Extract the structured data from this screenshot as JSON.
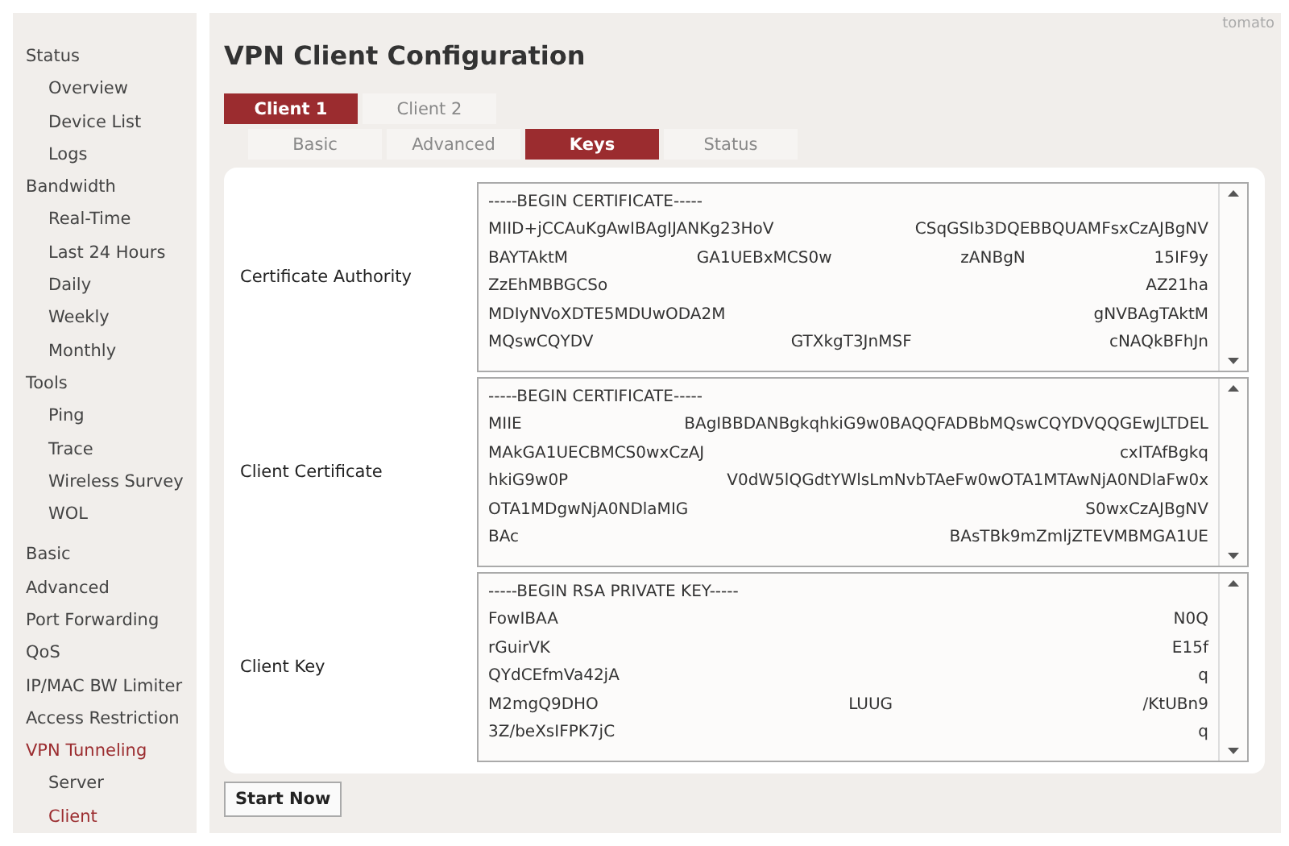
{
  "brand": "tomato",
  "sidebar": {
    "groups": [
      {
        "label": "Status",
        "selected": false,
        "children": [
          {
            "label": "Overview",
            "selected": false
          },
          {
            "label": "Device List",
            "selected": false
          },
          {
            "label": "Logs",
            "selected": false
          }
        ]
      },
      {
        "label": "Bandwidth",
        "selected": false,
        "children": [
          {
            "label": "Real-Time",
            "selected": false
          },
          {
            "label": "Last 24 Hours",
            "selected": false
          },
          {
            "label": "Daily",
            "selected": false
          },
          {
            "label": "Weekly",
            "selected": false
          },
          {
            "label": "Monthly",
            "selected": false
          }
        ]
      },
      {
        "label": "Tools",
        "selected": false,
        "children": [
          {
            "label": "Ping",
            "selected": false
          },
          {
            "label": "Trace",
            "selected": false
          },
          {
            "label": "Wireless Survey",
            "selected": false
          },
          {
            "label": "WOL",
            "selected": false
          }
        ]
      }
    ],
    "sections": [
      {
        "label": "Basic",
        "selected": false
      },
      {
        "label": "Advanced",
        "selected": false
      },
      {
        "label": "Port Forwarding",
        "selected": false
      },
      {
        "label": "QoS",
        "selected": false
      },
      {
        "label": "IP/MAC BW Limiter",
        "selected": false
      },
      {
        "label": "Access Restriction",
        "selected": false
      },
      {
        "label": "VPN Tunneling",
        "selected": true,
        "children": [
          {
            "label": "Server",
            "selected": false
          },
          {
            "label": "Client",
            "selected": true
          }
        ]
      }
    ]
  },
  "title": "VPN Client Configuration",
  "client_tabs": [
    {
      "label": "Client 1",
      "selected": true
    },
    {
      "label": "Client 2",
      "selected": false
    }
  ],
  "section_tabs": [
    {
      "label": "Basic",
      "selected": false
    },
    {
      "label": "Advanced",
      "selected": false
    },
    {
      "label": "Keys",
      "selected": true
    },
    {
      "label": "Status",
      "selected": false
    }
  ],
  "fields": [
    {
      "label": "Certificate Authority",
      "lines": [
        [
          "-----BEGIN CERTIFICATE-----"
        ],
        [
          "MIID+jCCAuKgAwIBAgIJANKg23HoV",
          "CSqGSIb3DQEBBQUAMFsxCzAJBgNV"
        ],
        [
          "BAYTAktM",
          "GA1UEBxMCS0w",
          "zANBgN",
          "15IF9y"
        ],
        [
          "ZzEhMBBGCSo",
          "AZ21ha"
        ],
        [
          "MDIyNVoXDTE5MDUwODA2M",
          "gNVBAgTAktM"
        ],
        [
          "MQswCQYDV",
          "GTXkgT3JnMSF",
          "cNAQkBFhJn"
        ]
      ]
    },
    {
      "label": "Client Certificate",
      "lines": [
        [
          "-----BEGIN CERTIFICATE-----"
        ],
        [
          "MIIE",
          "BAgIBBDANBgkqhkiG9w0BAQQFADBbMQswCQYDVQQGEwJLTDEL"
        ],
        [
          "MAkGA1UECBMCS0wxCzAJ",
          "cxITAfBgkq"
        ],
        [
          "hkiG9w0P",
          "V0dW5lQGdtYWlsLmNvbTAeFw0wOTA1MTAwNjA0NDlaFw0x"
        ],
        [
          "OTA1MDgwNjA0NDlaMIG",
          "S0wxCzAJBgNV"
        ],
        [
          "BAc",
          "BAsTBk9mZmljZTEVMBMGA1UE"
        ]
      ]
    },
    {
      "label": "Client Key",
      "lines": [
        [
          "-----BEGIN RSA PRIVATE KEY-----"
        ],
        [
          "FowIBAA",
          "N0Q"
        ],
        [
          "rGuirVK",
          "E15f"
        ],
        [
          "QYdCEfmVa42jA",
          "q"
        ],
        [
          "M2mgQ9DHO",
          "LUUG",
          "/KtUBn9"
        ],
        [
          "3Z/beXsIFPK7jC",
          "q"
        ]
      ]
    }
  ],
  "start_button": "Start Now"
}
